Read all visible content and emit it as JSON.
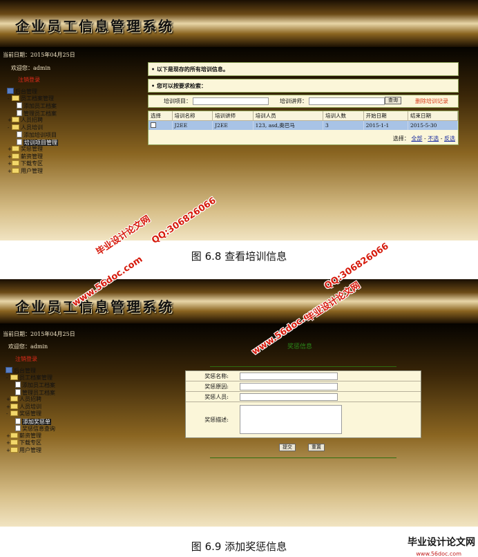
{
  "screen1": {
    "app_title": "企业员工信息管理系统",
    "date_text": "当前日期：2015年04月25日",
    "welcome": "欢迎您：admin",
    "logout": "注销登录",
    "tree": [
      {
        "label": "后台管理",
        "level": 0,
        "type": "root",
        "toggle": ""
      },
      {
        "label": "员工档案管理",
        "level": 1,
        "type": "folder",
        "toggle": "-"
      },
      {
        "label": "添加员工档案",
        "level": 2,
        "type": "doc",
        "toggle": ""
      },
      {
        "label": "管理员工档案",
        "level": 2,
        "type": "doc",
        "toggle": ""
      },
      {
        "label": "人员招聘",
        "level": 1,
        "type": "folder",
        "toggle": "+"
      },
      {
        "label": "人员培训",
        "level": 1,
        "type": "folder",
        "toggle": "-"
      },
      {
        "label": "添加培训项目",
        "level": 2,
        "type": "doc",
        "toggle": ""
      },
      {
        "label": "培训项目管理",
        "level": 2,
        "type": "doc",
        "toggle": "",
        "selected": true
      },
      {
        "label": "奖惩管理",
        "level": 1,
        "type": "folder",
        "toggle": "+"
      },
      {
        "label": "薪资管理",
        "level": 1,
        "type": "folder",
        "toggle": "+"
      },
      {
        "label": "下载专区",
        "level": 1,
        "type": "folder",
        "toggle": "+"
      },
      {
        "label": "用户管理",
        "level": 1,
        "type": "folder",
        "toggle": "+"
      }
    ],
    "heading1": "• 以下是现存的所有培训信息。",
    "heading2": "• 您可以按要求检索：",
    "search": {
      "project_label": "培训项目：",
      "teacher_label": "培训讲师：",
      "search_button": "查询",
      "delete_link": "删除培训记录"
    },
    "table": {
      "headers": [
        "选择",
        "培训名称",
        "培训讲师",
        "培训人员",
        "培训人数",
        "开始日期",
        "结束日期"
      ],
      "rows": [
        [
          "",
          "J2EE",
          "J2EE",
          "123, asd,奥巴马",
          "3",
          "2015-1-1",
          "2015-5-30"
        ]
      ]
    },
    "select_label": "选择：",
    "select_all": "全部",
    "select_none": "不选",
    "select_invert": "反选"
  },
  "caption1": "图 6.8  查看培训信息",
  "screen2": {
    "app_title": "企业员工信息管理系统",
    "date_text": "当前日期：2015年04月25日",
    "welcome": "欢迎您：admin",
    "logout": "注销登录",
    "tree": [
      {
        "label": "后台管理",
        "level": 0,
        "type": "root",
        "toggle": ""
      },
      {
        "label": "员工档案管理",
        "level": 1,
        "type": "folder",
        "toggle": "-"
      },
      {
        "label": "添加员工档案",
        "level": 2,
        "type": "doc",
        "toggle": ""
      },
      {
        "label": "管理员工档案",
        "level": 2,
        "type": "doc",
        "toggle": ""
      },
      {
        "label": "人员招聘",
        "level": 1,
        "type": "folder",
        "toggle": "+"
      },
      {
        "label": "人员培训",
        "level": 1,
        "type": "folder",
        "toggle": "+"
      },
      {
        "label": "奖惩管理",
        "level": 1,
        "type": "folder",
        "toggle": "-"
      },
      {
        "label": "添加奖惩单",
        "level": 2,
        "type": "doc",
        "toggle": "",
        "selected": true
      },
      {
        "label": "奖惩信息查询",
        "level": 2,
        "type": "doc",
        "toggle": ""
      },
      {
        "label": "薪资管理",
        "level": 1,
        "type": "folder",
        "toggle": "+"
      },
      {
        "label": "下载专区",
        "level": 1,
        "type": "folder",
        "toggle": "+"
      },
      {
        "label": "用户管理",
        "level": 1,
        "type": "folder",
        "toggle": "+"
      }
    ],
    "form_title": "奖惩信息",
    "fields": {
      "name": "奖惩名称:",
      "reason": "奖惩原因:",
      "person": "奖惩人员:",
      "desc": "奖惩描述:"
    },
    "submit": "提交",
    "reset": "重置"
  },
  "caption2": "图 6.9  添加奖惩信息",
  "watermarks": {
    "site_name": "毕业设计论文网",
    "qq": "QQ:306826066",
    "url": "www.56doc.com",
    "logo_text": "毕业设计论文网",
    "logo_url": "www.56doc.com"
  },
  "colors": {
    "watermark": "#d61a0c",
    "selected_row": "#a8c3e6",
    "panel_bg": "#fbf6d9",
    "form_title": "#2a8a1a"
  }
}
